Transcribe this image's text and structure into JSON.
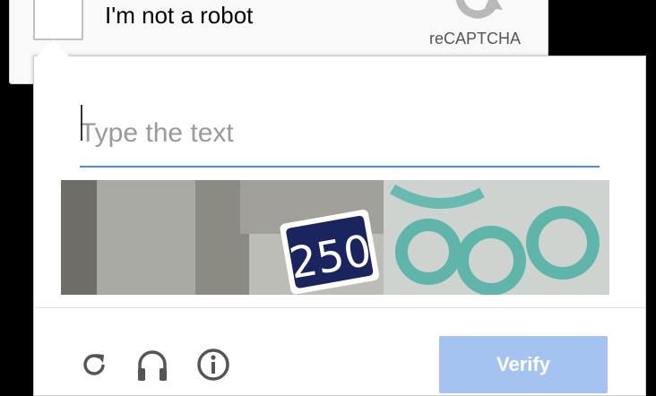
{
  "anchor": {
    "label": "I'm not a robot",
    "logo_text": "reCAPTCHA",
    "logo_icon": "recaptcha-logo-icon"
  },
  "challenge": {
    "input_placeholder": "Type the text",
    "input_value": "",
    "captcha_text": "250",
    "verify_label": "Verify"
  },
  "toolbar": {
    "icons": [
      "reload-icon",
      "headphones-icon",
      "info-icon"
    ]
  },
  "colors": {
    "accent": "#4a90e2",
    "verify_bg": "#a4c3f0",
    "plate_bg": "#1a2560"
  }
}
